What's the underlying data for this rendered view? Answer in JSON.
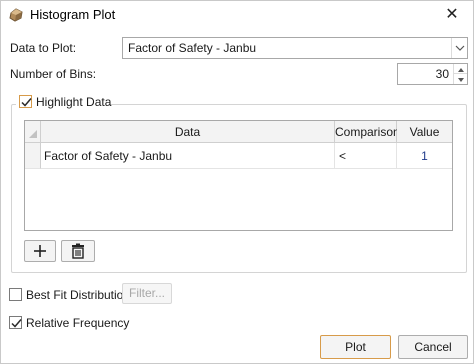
{
  "window": {
    "title": "Histogram Plot",
    "close_glyph": "✕",
    "app_icon": "rock-block-icon"
  },
  "form": {
    "data_to_plot_label": "Data to Plot:",
    "data_to_plot_value": "Factor of Safety - Janbu",
    "number_of_bins_label": "Number of Bins:",
    "number_of_bins_value": "30"
  },
  "highlight": {
    "label": "Highlight Data",
    "checked": true,
    "table": {
      "columns": [
        "Data",
        "Comparison",
        "Value"
      ],
      "rows": [
        {
          "data": "Factor of Safety - Janbu",
          "comparison": "<",
          "value": "1"
        }
      ]
    },
    "add_icon": "plus-icon",
    "delete_icon": "trash-icon"
  },
  "options": {
    "best_fit_label": "Best Fit Distribution",
    "best_fit_checked": false,
    "filter_label": "Filter...",
    "relative_frequency_label": "Relative Frequency",
    "relative_frequency_checked": true
  },
  "footer": {
    "plot_label": "Plot",
    "cancel_label": "Cancel"
  },
  "colors": {
    "value_text": "#1e3a8a",
    "default_button_border": "#d79b4a",
    "highlight_checkbox_border": "#d79b4a"
  }
}
